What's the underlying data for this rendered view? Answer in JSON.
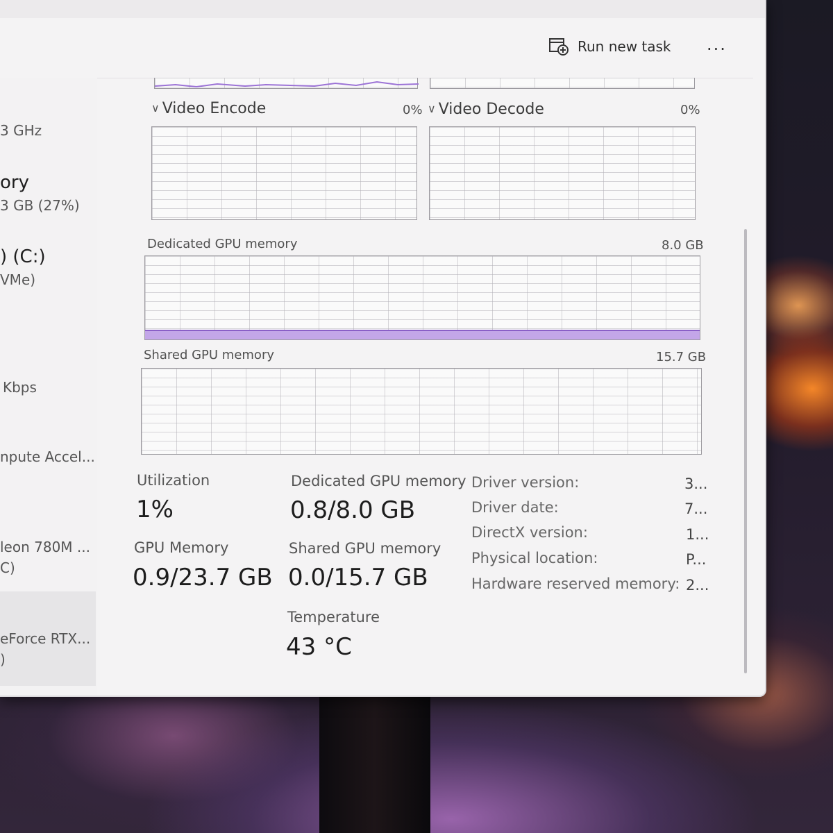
{
  "toolbar": {
    "run_new_task_label": "Run new task",
    "more_label": "..."
  },
  "sidebar": {
    "items": [
      {
        "line1": "",
        "line2": "3 GHz"
      },
      {
        "line1": "ory",
        "line2": "3 GB (27%)"
      },
      {
        "line1": ") (C:)",
        "line2": "VMe)"
      },
      {
        "line1": "",
        "line2": "Kbps"
      },
      {
        "line1": "",
        "line2": "npute Accel..."
      },
      {
        "line1": "leon 780M ...",
        "line2": "C)"
      },
      {
        "line1": "eForce RTX...",
        "line2": ")"
      }
    ]
  },
  "graphs": {
    "video_encode": {
      "title": "Video Encode",
      "percent": "0%"
    },
    "video_decode": {
      "title": "Video Decode",
      "percent": "0%"
    },
    "dedicated_memory": {
      "title": "Dedicated GPU memory",
      "max": "8.0 GB",
      "usage_fraction": 0.1
    },
    "shared_memory": {
      "title": "Shared GPU memory",
      "max": "15.7 GB",
      "usage_fraction": 0.0
    }
  },
  "stats": {
    "utilization": {
      "label": "Utilization",
      "value": "1%"
    },
    "dedicated": {
      "label": "Dedicated GPU memory",
      "value": "0.8/8.0 GB"
    },
    "gpu_memory": {
      "label": "GPU Memory",
      "value": "0.9/23.7 GB"
    },
    "shared": {
      "label": "Shared GPU memory",
      "value": "0.0/15.7 GB"
    },
    "temperature": {
      "label": "Temperature",
      "value": "43 °C"
    }
  },
  "properties": [
    {
      "name": "Driver version:",
      "value": "3..."
    },
    {
      "name": "Driver date:",
      "value": "7..."
    },
    {
      "name": "DirectX version:",
      "value": "1..."
    },
    {
      "name": "Physical location:",
      "value": "P..."
    },
    {
      "name": "Hardware reserved memory:",
      "value": "2..."
    }
  ],
  "colors": {
    "memory_fill": "#c3a6e8",
    "memory_line": "#8a5fc7"
  }
}
